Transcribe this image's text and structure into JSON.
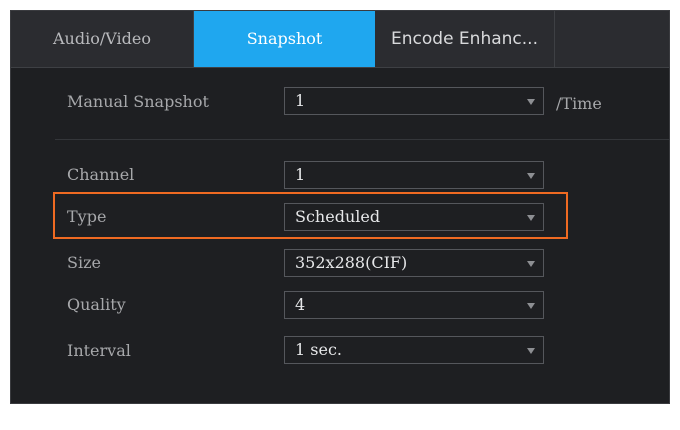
{
  "tabs": [
    {
      "label": "Audio/Video",
      "active": false
    },
    {
      "label": "Snapshot",
      "active": true
    },
    {
      "label": "Encode Enhanc...",
      "active": false
    }
  ],
  "manual_snapshot": {
    "label": "Manual Snapshot",
    "value": "1",
    "unit": "/Time"
  },
  "fields": {
    "channel": {
      "label": "Channel",
      "value": "1"
    },
    "type": {
      "label": "Type",
      "value": "Scheduled"
    },
    "size": {
      "label": "Size",
      "value": "352x288(CIF)"
    },
    "quality": {
      "label": "Quality",
      "value": "4"
    },
    "interval": {
      "label": "Interval",
      "value": "1 sec."
    }
  },
  "colors": {
    "active_tab": "#1fa7ef",
    "highlight_border": "#ef6a22",
    "panel_background": "#1e1f22"
  }
}
